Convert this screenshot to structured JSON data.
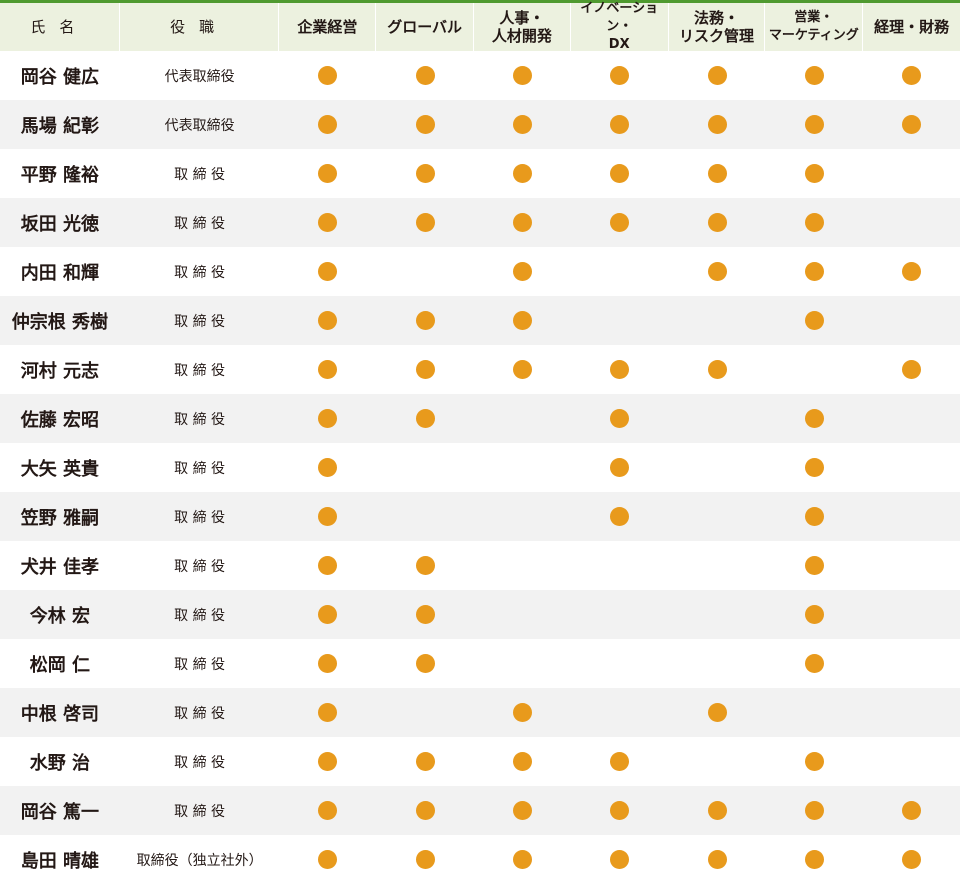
{
  "colors": {
    "accent": "#4f9a2f",
    "dot": "#e89a1c",
    "header_bg": "#ecf1df",
    "row_alt": "#f2f2f2"
  },
  "header": {
    "name": "氏名",
    "role": "役職",
    "skills": [
      "企業経営",
      "グローバル",
      "人事・\n人材開発",
      "イノベーション・\nDX",
      "法務・\nリスク管理",
      "営業・\nマーケティング",
      "経理・財務"
    ]
  },
  "rows": [
    {
      "name": "岡谷 健広",
      "role": "代表取締役",
      "marks": [
        1,
        1,
        1,
        1,
        1,
        1,
        1
      ]
    },
    {
      "name": "馬場 紀彰",
      "role": "代表取締役",
      "marks": [
        1,
        1,
        1,
        1,
        1,
        1,
        1
      ]
    },
    {
      "name": "平野 隆裕",
      "role": "取 締 役",
      "marks": [
        1,
        1,
        1,
        1,
        1,
        1,
        0
      ]
    },
    {
      "name": "坂田 光徳",
      "role": "取 締 役",
      "marks": [
        1,
        1,
        1,
        1,
        1,
        1,
        0
      ]
    },
    {
      "name": "内田 和輝",
      "role": "取 締 役",
      "marks": [
        1,
        0,
        1,
        0,
        1,
        1,
        1
      ]
    },
    {
      "name": "仲宗根 秀樹",
      "role": "取 締 役",
      "marks": [
        1,
        1,
        1,
        0,
        0,
        1,
        0
      ]
    },
    {
      "name": "河村 元志",
      "role": "取 締 役",
      "marks": [
        1,
        1,
        1,
        1,
        1,
        0,
        1
      ]
    },
    {
      "name": "佐藤 宏昭",
      "role": "取 締 役",
      "marks": [
        1,
        1,
        0,
        1,
        0,
        1,
        0
      ]
    },
    {
      "name": "大矢 英貴",
      "role": "取 締 役",
      "marks": [
        1,
        0,
        0,
        1,
        0,
        1,
        0
      ]
    },
    {
      "name": "笠野 雅嗣",
      "role": "取 締 役",
      "marks": [
        1,
        0,
        0,
        1,
        0,
        1,
        0
      ]
    },
    {
      "name": "犬井 佳孝",
      "role": "取 締 役",
      "marks": [
        1,
        1,
        0,
        0,
        0,
        1,
        0
      ]
    },
    {
      "name": "今林 宏",
      "role": "取 締 役",
      "marks": [
        1,
        1,
        0,
        0,
        0,
        1,
        0
      ]
    },
    {
      "name": "松岡 仁",
      "role": "取 締 役",
      "marks": [
        1,
        1,
        0,
        0,
        0,
        1,
        0
      ]
    },
    {
      "name": "中根 啓司",
      "role": "取 締 役",
      "marks": [
        1,
        0,
        1,
        0,
        1,
        0,
        0
      ]
    },
    {
      "name": "水野 治",
      "role": "取 締 役",
      "marks": [
        1,
        1,
        1,
        1,
        0,
        1,
        0
      ]
    },
    {
      "name": "岡谷 篤一",
      "role": "取 締 役",
      "marks": [
        1,
        1,
        1,
        1,
        1,
        1,
        1
      ]
    },
    {
      "name": "島田 晴雄",
      "role": "取締役（独立社外）",
      "marks": [
        1,
        1,
        1,
        1,
        1,
        1,
        1
      ]
    }
  ]
}
